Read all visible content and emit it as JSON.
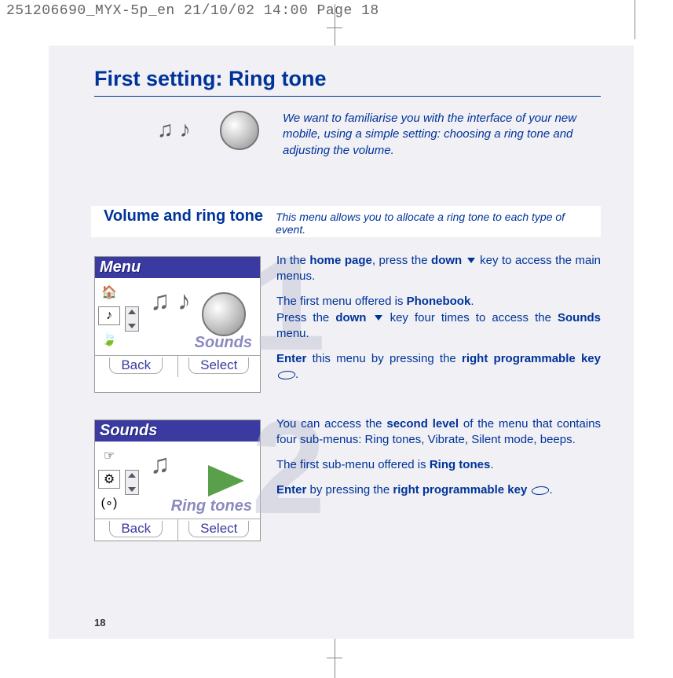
{
  "header": "251206690_MYX-5p_en  21/10/02  14:00  Page 18",
  "title": "First setting: Ring tone",
  "intro": "We want to familiarise you with the interface of your new mobile, using a simple setting: choosing a ring tone and adjusting the volume.",
  "section": {
    "heading": "Volume and ring tone",
    "desc": "This menu allows you to allocate a ring tone to each type of event."
  },
  "steps": [
    {
      "num": "1",
      "screen_title": "Menu",
      "screen_label": "Sounds",
      "soft_left": "Back",
      "soft_right": "Select",
      "p1_a": "In the ",
      "p1_b": "home page",
      "p1_c": ", press the ",
      "p1_d": "down",
      "p1_e": " key to access the main menus.",
      "p2_a": "The first menu offered is ",
      "p2_b": "Phonebook",
      "p2_c": ".",
      "p3_a": "Press the ",
      "p3_b": "down",
      "p3_c": " key four times to access the ",
      "p3_d": "Sounds",
      "p3_e": " menu.",
      "p4_a": "Enter",
      "p4_b": " this menu by pressing the ",
      "p4_c": "right programmable key",
      "p4_d": "."
    },
    {
      "num": "2",
      "screen_title": "Sounds",
      "screen_label": "Ring tones",
      "soft_left": "Back",
      "soft_right": "Select",
      "p1_a": "You can access the ",
      "p1_b": "second level",
      "p1_c": " of the menu that contains four sub-menus: Ring tones, Vibrate, Silent mode, beeps.",
      "p2_a": "The first sub-menu offered is ",
      "p2_b": "Ring tones",
      "p2_c": ".",
      "p3_a": "Enter",
      "p3_b": " by pressing the ",
      "p3_c": "right programmable key",
      "p3_d": "."
    }
  ],
  "page_number": "18"
}
